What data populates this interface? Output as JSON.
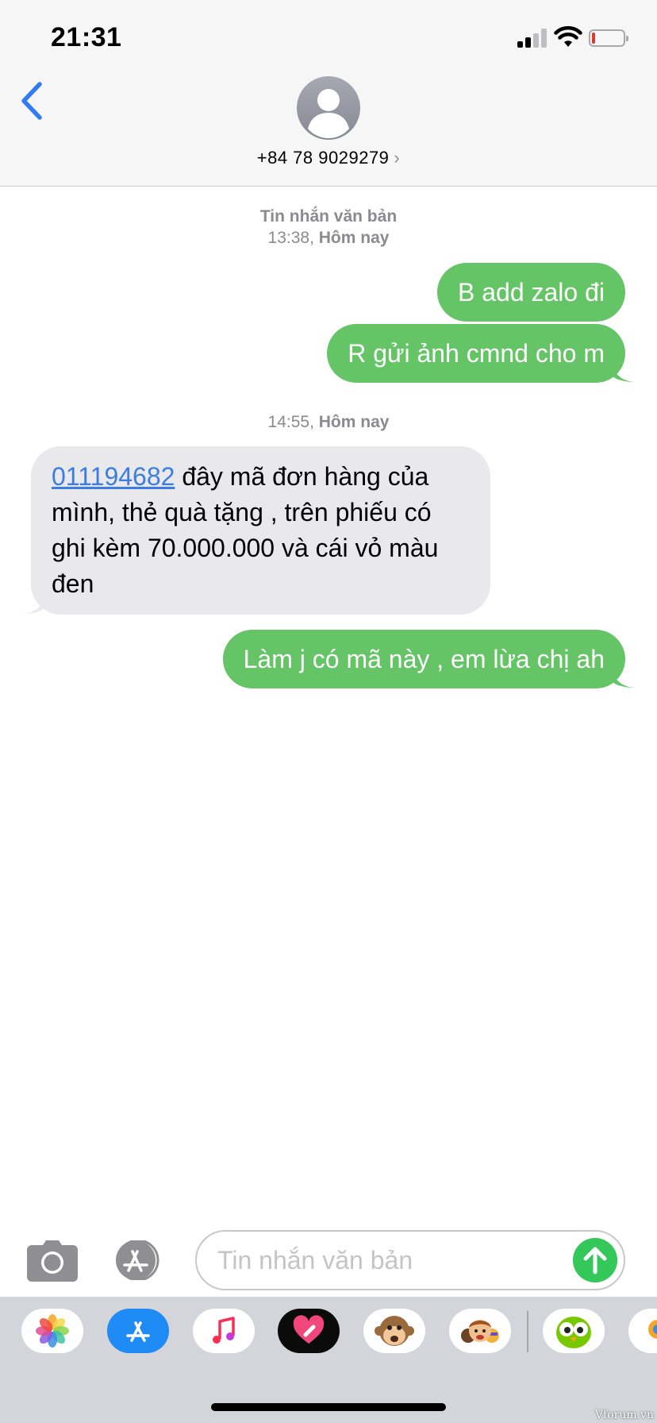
{
  "status_bar": {
    "time": "21:31"
  },
  "header": {
    "contact": "+84 78 9029279"
  },
  "conversation": {
    "stamp1": {
      "label": "Tin nhắn văn bản",
      "time": "13:38,",
      "day": "Hôm nay"
    },
    "out1": "B add zalo đi",
    "out2": "R gửi ảnh cmnd cho m",
    "stamp2": {
      "time": "14:55,",
      "day": "Hôm nay"
    },
    "in1": {
      "link": "011194682",
      "text": " đây mã đơn hàng của mình, thẻ quà tặng , trên phiếu có ghi kèm 70.000.000 và cái vỏ màu đen"
    },
    "out3": "Làm j có mã này , em lừa chị ah"
  },
  "composer": {
    "placeholder": "Tin nhắn văn bản"
  },
  "watermark": "Vforum.vn",
  "colors": {
    "outgoing": "#65c466",
    "incoming": "#e9e9eb",
    "link": "#3b7de3",
    "send": "#34c759"
  }
}
